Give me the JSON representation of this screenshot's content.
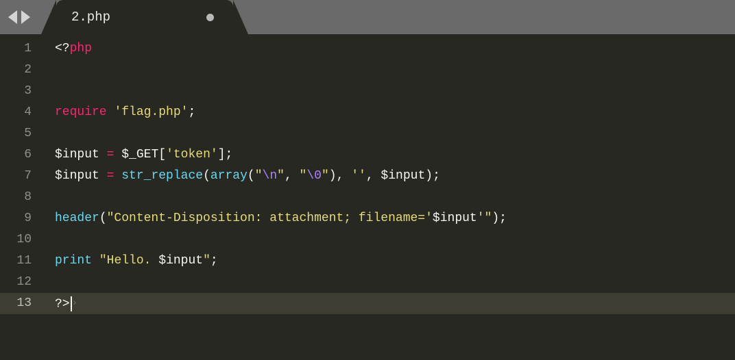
{
  "topbar": {
    "tab_filename": "2.php"
  },
  "gutter": {
    "lines": [
      "1",
      "2",
      "3",
      "4",
      "5",
      "6",
      "7",
      "8",
      "9",
      "10",
      "11",
      "12",
      "13"
    ],
    "active_line": 13
  },
  "code": {
    "l1": {
      "tag_open": "<?",
      "php": "php"
    },
    "l4": {
      "require": "require",
      "space": " ",
      "str": "'flag.php'",
      "semi": ";"
    },
    "l6": {
      "dollar": "$",
      "var": "input",
      "assign": " = ",
      "dollar2": "$",
      "get": "_GET",
      "br_open": "[",
      "key": "'token'",
      "br_close": "]",
      "semi": ";"
    },
    "l7": {
      "dollar": "$",
      "var": "input",
      "assign": " = ",
      "fn": "str_replace",
      "p_open": "(",
      "arr": "array",
      "p2_open": "(",
      "q1": "\"",
      "esc1": "\\n",
      "q1c": "\"",
      "comma1": ", ",
      "q2": "\"",
      "esc2": "\\0",
      "q2c": "\"",
      "p2_close": ")",
      "comma2": ", ",
      "empty": "''",
      "comma3": ", ",
      "dollar2": "$",
      "var2": "input",
      "p_close": ")",
      "semi": ";"
    },
    "l9": {
      "fn": "header",
      "p_open": "(",
      "str1": "\"Content-Disposition: attachment; filename='",
      "dollar": "$",
      "var": "input",
      "str2": "'\"",
      "p_close": ")",
      "semi": ";"
    },
    "l11": {
      "print": "print",
      "space": " ",
      "q_open": "\"",
      "txt": "Hello. ",
      "dollar": "$",
      "var": "input",
      "q_close": "\"",
      "semi": ";"
    },
    "l13": {
      "tag_close": "?>",
      "caret": "›"
    }
  }
}
